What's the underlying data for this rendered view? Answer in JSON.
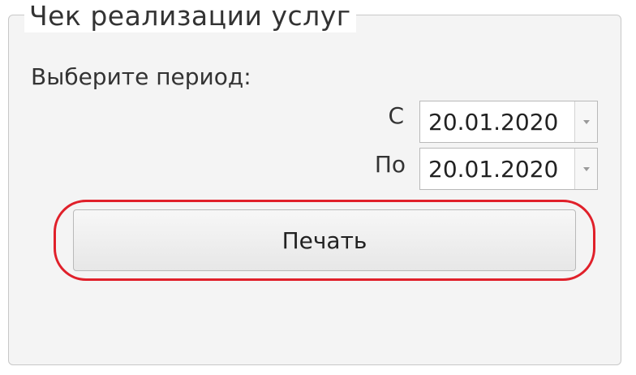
{
  "panel": {
    "title": "Чек реализации услуг",
    "prompt": "Выберите период:"
  },
  "period": {
    "from_label": "С",
    "from_value": "20.01.2020",
    "to_label": "По",
    "to_value": "20.01.2020"
  },
  "actions": {
    "print_label": "Печать"
  },
  "icons": {
    "dropdown": "chevron-down-icon"
  },
  "colors": {
    "highlight": "#e0202a"
  }
}
